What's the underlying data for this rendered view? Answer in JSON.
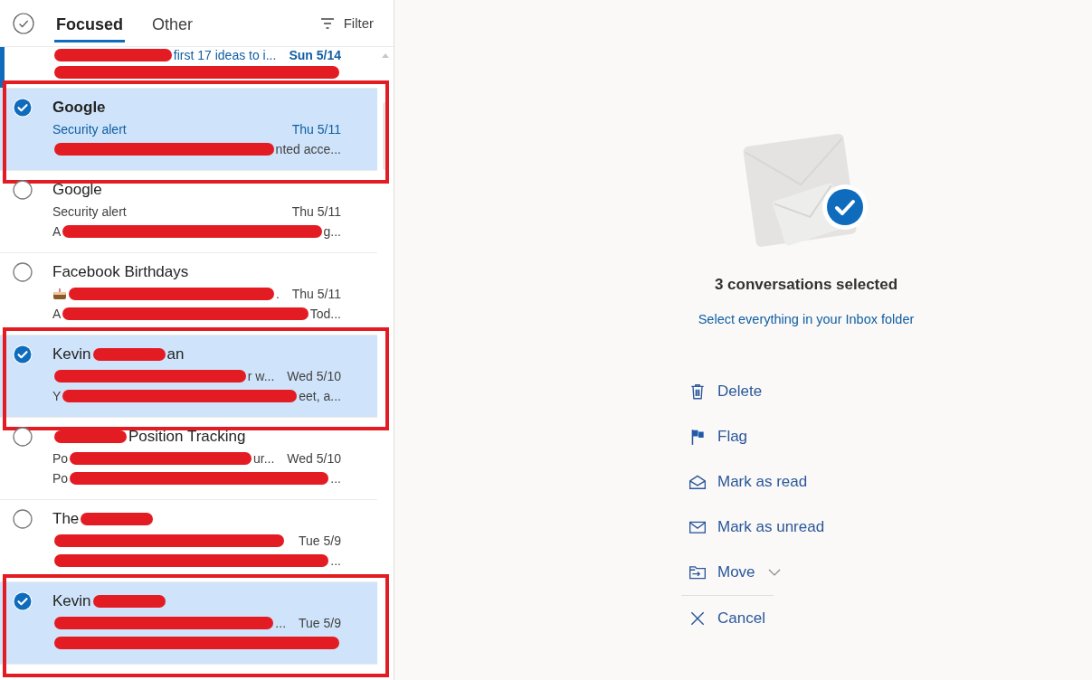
{
  "header": {
    "select_all": {
      "checked": false
    },
    "tabs": [
      {
        "label": "Focused",
        "selected": true
      },
      {
        "label": "Other",
        "selected": false
      }
    ],
    "filter": "Filter"
  },
  "messages": [
    {
      "unread": true,
      "subject": [
        {
          "kind": "redaction"
        },
        {
          "kind": "text",
          "text": "first 17 ideas to i..."
        }
      ],
      "date": "Sun 5/14",
      "preview": [
        {
          "kind": "redaction"
        }
      ]
    },
    {
      "selected": true,
      "unread": true,
      "annotated": true,
      "sender": [
        {
          "kind": "text",
          "text": "Google"
        }
      ],
      "subject": [
        {
          "kind": "text",
          "text": "Security alert"
        }
      ],
      "date": "Thu 5/11",
      "preview": [
        {
          "kind": "redaction"
        },
        {
          "kind": "text",
          "text": "nted acce..."
        }
      ]
    },
    {
      "selected": false,
      "unread": false,
      "annotated": false,
      "sender": [
        {
          "kind": "text",
          "text": "Google"
        }
      ],
      "subject": [
        {
          "kind": "text",
          "text": "Security alert"
        }
      ],
      "date": "Thu 5/11",
      "preview": [
        {
          "kind": "text",
          "text": "A"
        },
        {
          "kind": "redaction"
        },
        {
          "kind": "text",
          "text": "g..."
        }
      ]
    },
    {
      "selected": false,
      "unread": false,
      "annotated": false,
      "sender": [
        {
          "kind": "text",
          "text": "Facebook Birthdays"
        }
      ],
      "subject": [
        {
          "kind": "cake"
        },
        {
          "kind": "redaction"
        },
        {
          "kind": "text",
          "text": "."
        }
      ],
      "date": "Thu 5/11",
      "preview": [
        {
          "kind": "text",
          "text": "A"
        },
        {
          "kind": "redaction"
        },
        {
          "kind": "text",
          "text": "Tod..."
        }
      ]
    },
    {
      "selected": true,
      "unread": false,
      "annotated": true,
      "sender": [
        {
          "kind": "text",
          "text": "Kevin"
        },
        {
          "kind": "redaction"
        },
        {
          "kind": "text",
          "text": "an"
        }
      ],
      "subject": [
        {
          "kind": "redaction"
        },
        {
          "kind": "text",
          "text": "r w..."
        }
      ],
      "date": "Wed 5/10",
      "preview": [
        {
          "kind": "text",
          "text": "Y"
        },
        {
          "kind": "redaction"
        },
        {
          "kind": "text",
          "text": "eet, a..."
        }
      ]
    },
    {
      "selected": false,
      "unread": false,
      "annotated": false,
      "sender": [
        {
          "kind": "redaction"
        },
        {
          "kind": "text",
          "text": "Position Tracking"
        }
      ],
      "subject": [
        {
          "kind": "text",
          "text": "Po"
        },
        {
          "kind": "redaction"
        },
        {
          "kind": "text",
          "text": "ur..."
        }
      ],
      "date": "Wed 5/10",
      "preview": [
        {
          "kind": "text",
          "text": "Po"
        },
        {
          "kind": "redaction"
        },
        {
          "kind": "text",
          "text": "..."
        }
      ]
    },
    {
      "selected": false,
      "unread": false,
      "annotated": false,
      "sender": [
        {
          "kind": "text",
          "text": "The"
        },
        {
          "kind": "redaction"
        }
      ],
      "subject": [
        {
          "kind": "redaction"
        }
      ],
      "date": "Tue 5/9",
      "preview": [
        {
          "kind": "redaction"
        },
        {
          "kind": "text",
          "text": "..."
        }
      ]
    },
    {
      "selected": true,
      "unread": false,
      "annotated": true,
      "sender": [
        {
          "kind": "text",
          "text": "Kevin"
        },
        {
          "kind": "redaction"
        }
      ],
      "subject": [
        {
          "kind": "redaction"
        },
        {
          "kind": "text",
          "text": "..."
        }
      ],
      "date": "Tue 5/9",
      "preview": [
        {
          "kind": "redaction"
        }
      ]
    }
  ],
  "selection": {
    "title": "3 conversations selected",
    "link": "Select everything in your Inbox folder",
    "actions": [
      {
        "kind": "delete",
        "label": "Delete"
      },
      {
        "kind": "flag",
        "label": "Flag"
      },
      {
        "kind": "read",
        "label": "Mark as read"
      },
      {
        "kind": "unread",
        "label": "Mark as unread"
      },
      {
        "kind": "move",
        "label": "Move"
      },
      {
        "kind": "cancel",
        "label": "Cancel"
      }
    ]
  }
}
